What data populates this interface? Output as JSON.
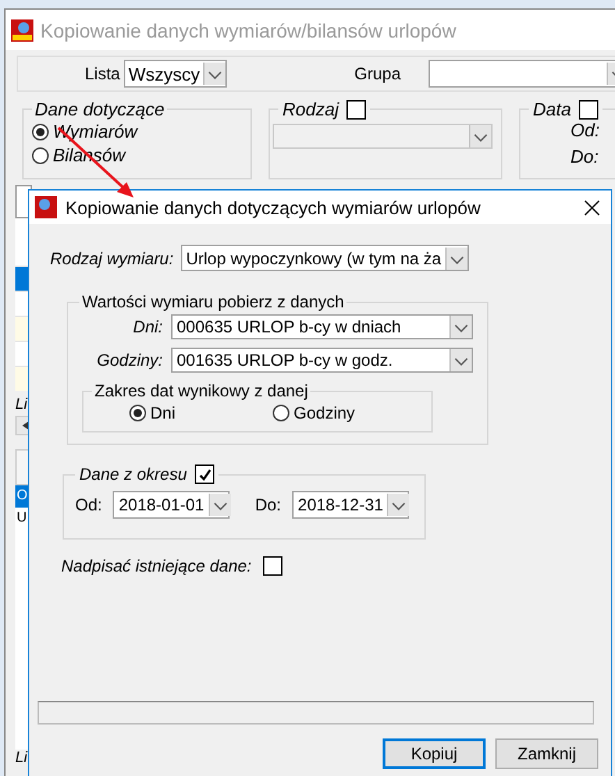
{
  "background_window": {
    "title": "Kopiowanie danych wymiarów/bilansów urlopów",
    "lista": {
      "label": "Lista",
      "value": "Wszyscy"
    },
    "grupa": {
      "label": "Grupa"
    },
    "dane_dotyczace": {
      "title": "Dane dotyczące",
      "options": [
        {
          "label": "Wymiarów",
          "selected": true
        },
        {
          "label": "Bilansów",
          "selected": false
        }
      ]
    },
    "rodzaj": {
      "label": "Rodzaj",
      "checked": false
    },
    "data": {
      "label": "Data",
      "checked": false,
      "od_label": "Od:",
      "do_label": "Do:"
    },
    "table_rows": [
      {
        "selected": true,
        "shaded": false
      },
      {
        "selected": false,
        "shaded": false
      },
      {
        "selected": false,
        "shaded": true
      },
      {
        "selected": false,
        "shaded": false
      },
      {
        "selected": false,
        "shaded": true
      }
    ],
    "left_fragments": [
      {
        "text": "Li",
        "kind": "label"
      },
      {
        "text": "O",
        "kind": "selected-row"
      },
      {
        "text": "U",
        "kind": "row"
      },
      {
        "text": "Li",
        "kind": "label"
      }
    ]
  },
  "dialog": {
    "title": "Kopiowanie danych dotyczących wymiarów urlopów",
    "rodzaj_wymiaru": {
      "label": "Rodzaj wymiaru:",
      "value": "Urlop wypoczynkowy (w tym na ża"
    },
    "wartosci": {
      "title": "Wartości wymiaru pobierz z danych",
      "fields": [
        {
          "label": "Dni:",
          "value": "000635 URLOP b-cy w dniach"
        },
        {
          "label": "Godziny:",
          "value": "001635 URLOP b-cy w godz."
        }
      ],
      "zakres": {
        "title": "Zakres dat wynikowy z danej",
        "options": [
          {
            "label": "Dni",
            "selected": true
          },
          {
            "label": "Godziny",
            "selected": false
          }
        ]
      }
    },
    "okres": {
      "title": "Dane z okresu",
      "checked": true,
      "od_label": "Od:",
      "od_value": "2018-01-01",
      "do_label": "Do:",
      "do_value": "2018-12-31"
    },
    "nadpisac": {
      "label": "Nadpisać istniejące dane:",
      "checked": false
    },
    "progress": {
      "level": 0
    },
    "buttons": [
      {
        "label": "Kopiuj",
        "default": true
      },
      {
        "label": "Zamknij",
        "default": false
      }
    ]
  }
}
